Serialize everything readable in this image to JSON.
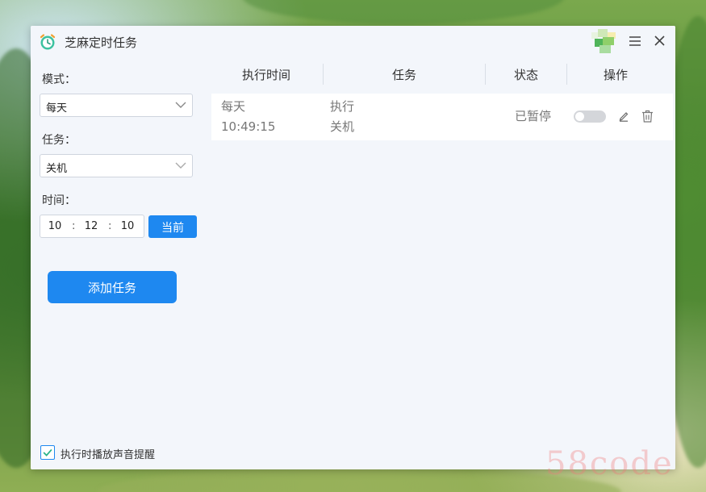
{
  "app": {
    "title": "芝麻定时任务",
    "accent_color": "#1e88f0",
    "icons": [
      "alarm-clock-icon",
      "menu-icon",
      "close-icon"
    ]
  },
  "sidebar": {
    "mode_label": "模式：",
    "mode_value": "每天",
    "task_label": "任务：",
    "task_value": "关机",
    "time_label": "时间：",
    "time": {
      "hour": "10",
      "minute": "12",
      "second": "10",
      "separator": ":"
    },
    "now_button": "当前",
    "add_button": "添加任务",
    "sound_checkbox": {
      "label": "执行时播放声音提醒",
      "checked": true
    }
  },
  "table": {
    "headers": [
      "执行时间",
      "任务",
      "状态",
      "操作"
    ],
    "rows": [
      {
        "freq": "每天",
        "time": "10:49:15",
        "action": "执行",
        "task": "关机",
        "status": "已暂停",
        "enabled": false
      }
    ]
  },
  "watermark": "58code"
}
